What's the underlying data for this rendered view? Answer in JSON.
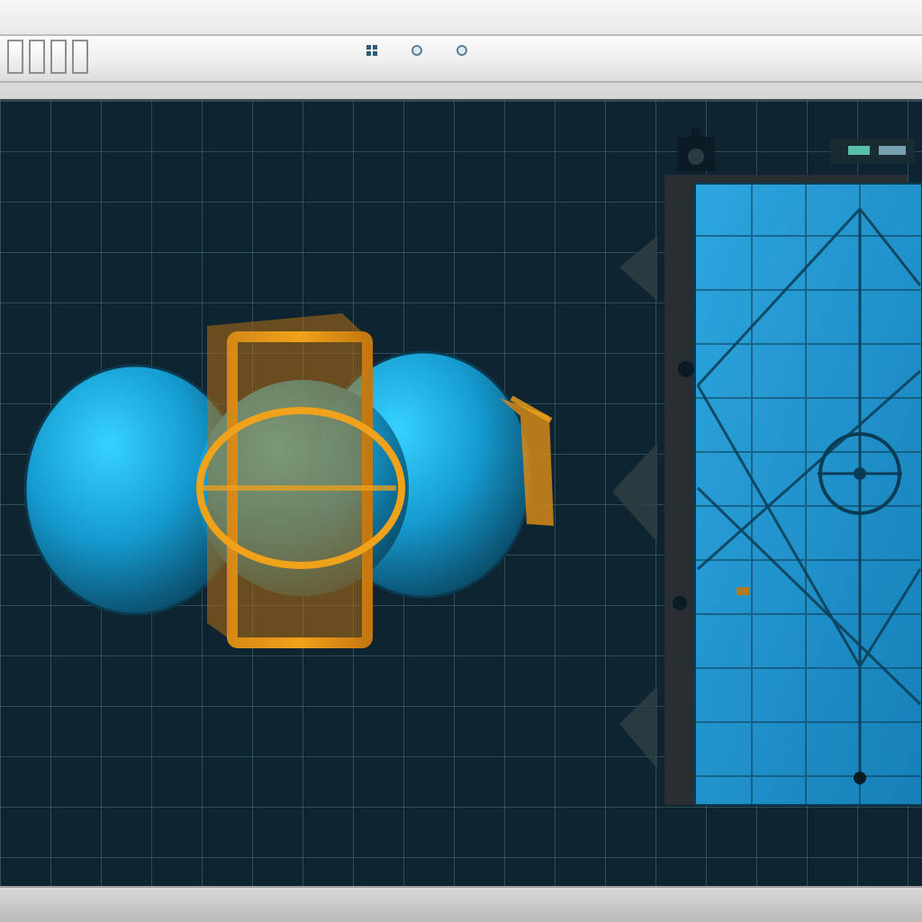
{
  "toolbar": {
    "tabs": [
      "tab",
      "tab",
      "tab",
      "tab"
    ],
    "icons": [
      "grid-icon",
      "ring-icon",
      "ring-icon"
    ]
  },
  "viewport": {
    "theme": {
      "background": "#0e2430",
      "grid": "#6996aa",
      "sphere": "#18a8d8",
      "frame": "#f0a21a",
      "panel": "#1f8ccf",
      "panel_border": "#2a2f33"
    }
  }
}
